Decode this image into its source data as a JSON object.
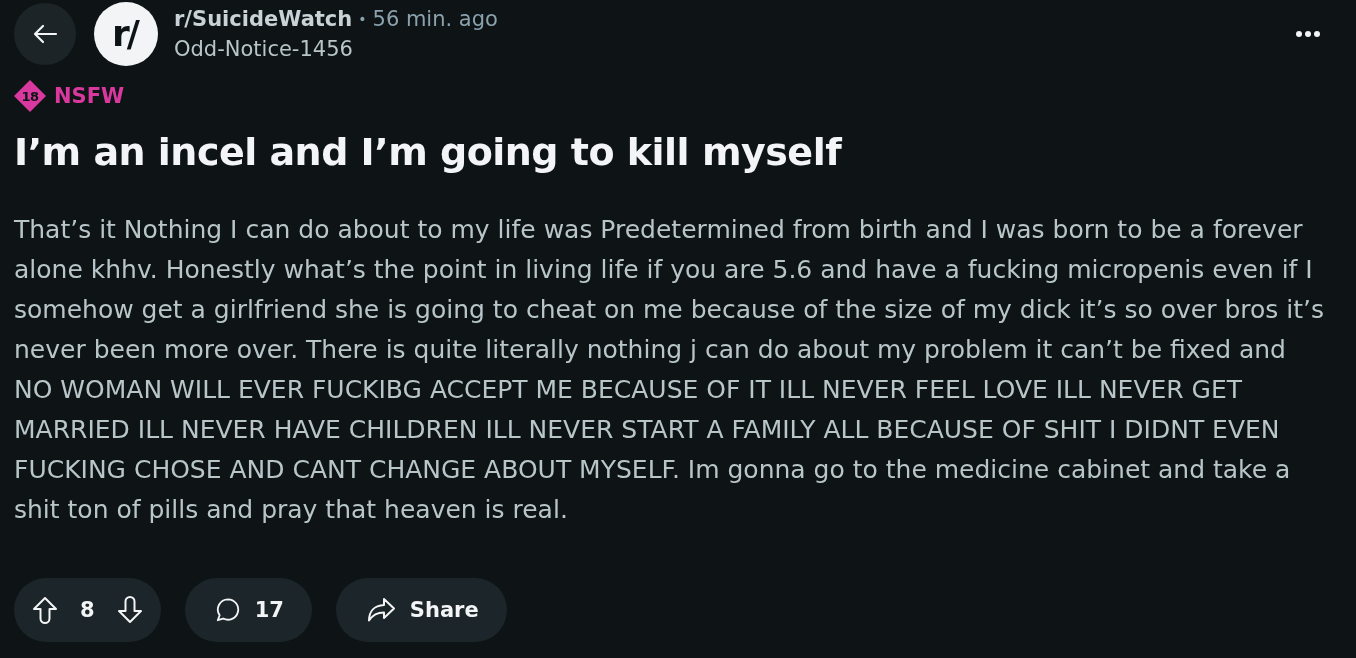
{
  "header": {
    "avatar_text": "r/",
    "subreddit": "r/SuicideWatch",
    "separator": "•",
    "time": "56 min. ago",
    "author": "Odd-Notice-1456"
  },
  "nsfw": {
    "badge": "18",
    "label": "NSFW"
  },
  "post": {
    "title": "I’m an incel and I’m going to kill myself",
    "body": "That’s it Nothing I can do about to my life was Predetermined from birth and I was born to be a forever alone khhv. Honestly what’s the point in living life if you are 5.6 and have a fucking micropenis even if I somehow get a girlfriend she is going to cheat on me because of the size of my dick it’s so over bros it’s never been more over. There is quite literally nothing j can do about my problem it can’t be fixed and NO WOMAN WILL EVER FUCKIBG ACCEPT ME BECAUSE OF IT ILL NEVER FEEL LOVE ILL NEVER GET MARRIED ILL NEVER HAVE CHILDREN ILL NEVER START A FAMILY ALL BECAUSE OF SHIT I DIDNT EVEN FUCKING CHOSE AND CANT CHANGE ABOUT MYSELF. Im gonna go to the medicine cabinet and take a shit ton of pills and pray that heaven is real."
  },
  "actions": {
    "votes": "8",
    "comments": "17",
    "share": "Share"
  }
}
